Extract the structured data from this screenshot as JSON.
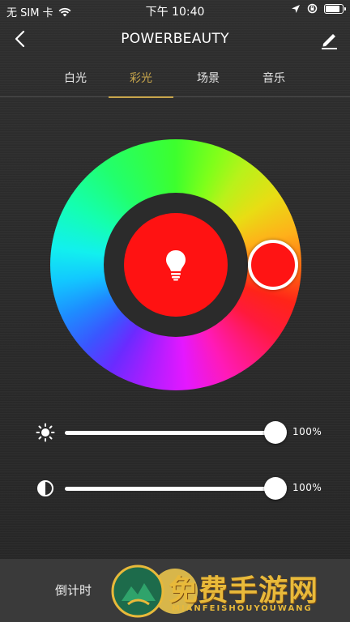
{
  "status_bar": {
    "carrier": "无 SIM 卡",
    "time": "下午 10:40",
    "battery_level": 0.9
  },
  "header": {
    "title": "POWERBEAUTY",
    "back_icon": "chevron-left-icon",
    "edit_icon": "pencil-icon"
  },
  "tabs": [
    {
      "label": "白光",
      "active": false
    },
    {
      "label": "彩光",
      "active": true
    },
    {
      "label": "场景",
      "active": false
    },
    {
      "label": "音乐",
      "active": false
    }
  ],
  "color_picker": {
    "selected_color": "#ff1212",
    "center_icon": "lightbulb-icon"
  },
  "sliders": {
    "brightness": {
      "icon": "sun-icon",
      "value": 100,
      "label": "100%"
    },
    "saturation": {
      "icon": "contrast-icon",
      "value": 100,
      "label": "100%"
    }
  },
  "bottom_bar": {
    "timer_label": "倒计时"
  },
  "watermark": {
    "text": "免费手游网",
    "subtext": "MIANFEISHOUYOUWANG"
  },
  "colors": {
    "accent": "#c8a64c",
    "background": "#2c2c2c"
  }
}
